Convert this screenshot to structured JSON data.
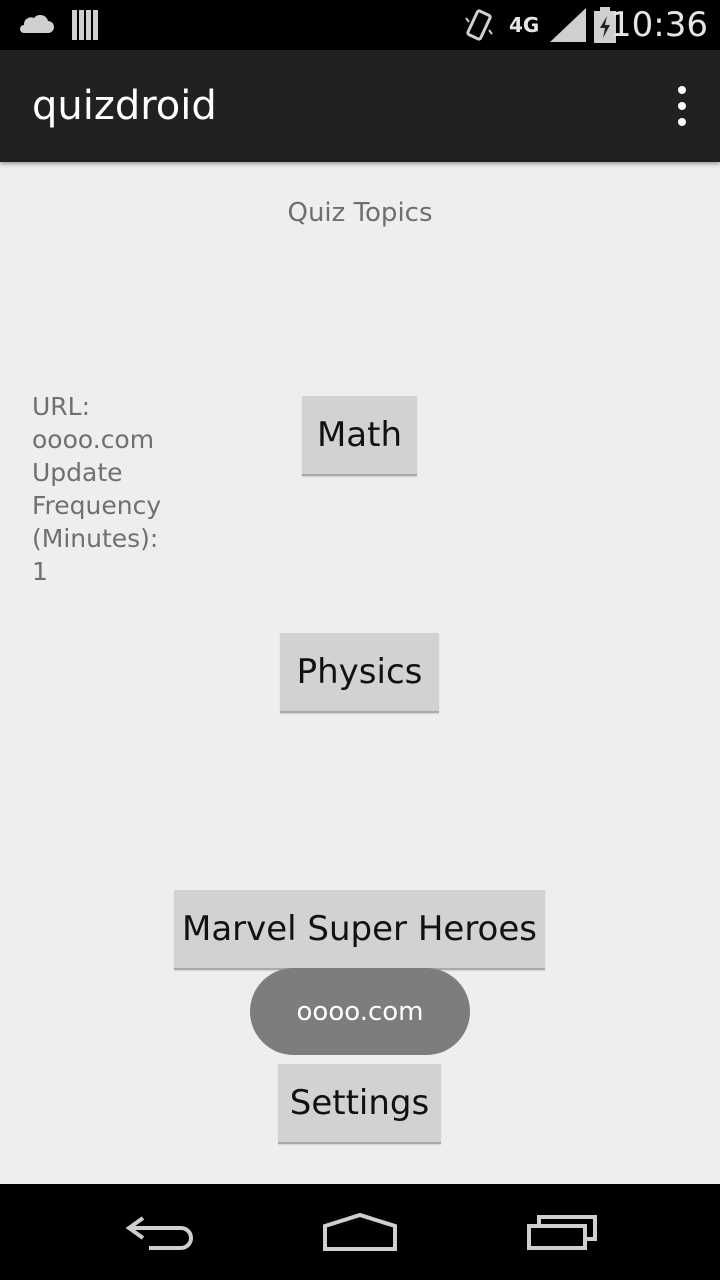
{
  "status_bar": {
    "time": "10:36",
    "network": "4G",
    "icons": [
      "cloud-icon",
      "storage-icon",
      "vibrate-icon",
      "signal-icon",
      "battery-icon"
    ]
  },
  "app_bar": {
    "title": "quizdroid",
    "menu_icon": "overflow-menu-icon"
  },
  "main": {
    "heading": "Quiz Topics",
    "info_lines": [
      "URL:",
      "oooo.com",
      "Update",
      "Frequency",
      "(Minutes):",
      "1"
    ],
    "topics": [
      "Math",
      "Physics",
      "Marvel Super Heroes"
    ],
    "toast": "oooo.com",
    "settings_label": "Settings"
  },
  "nav_bar": {
    "icons": [
      "back-icon",
      "home-icon",
      "recents-icon"
    ]
  },
  "colors": {
    "status_bar": "#000000",
    "action_bar": "#212121",
    "background": "#eeeeee",
    "button": "#d2d2d2",
    "toast": "#7d7d7d"
  }
}
